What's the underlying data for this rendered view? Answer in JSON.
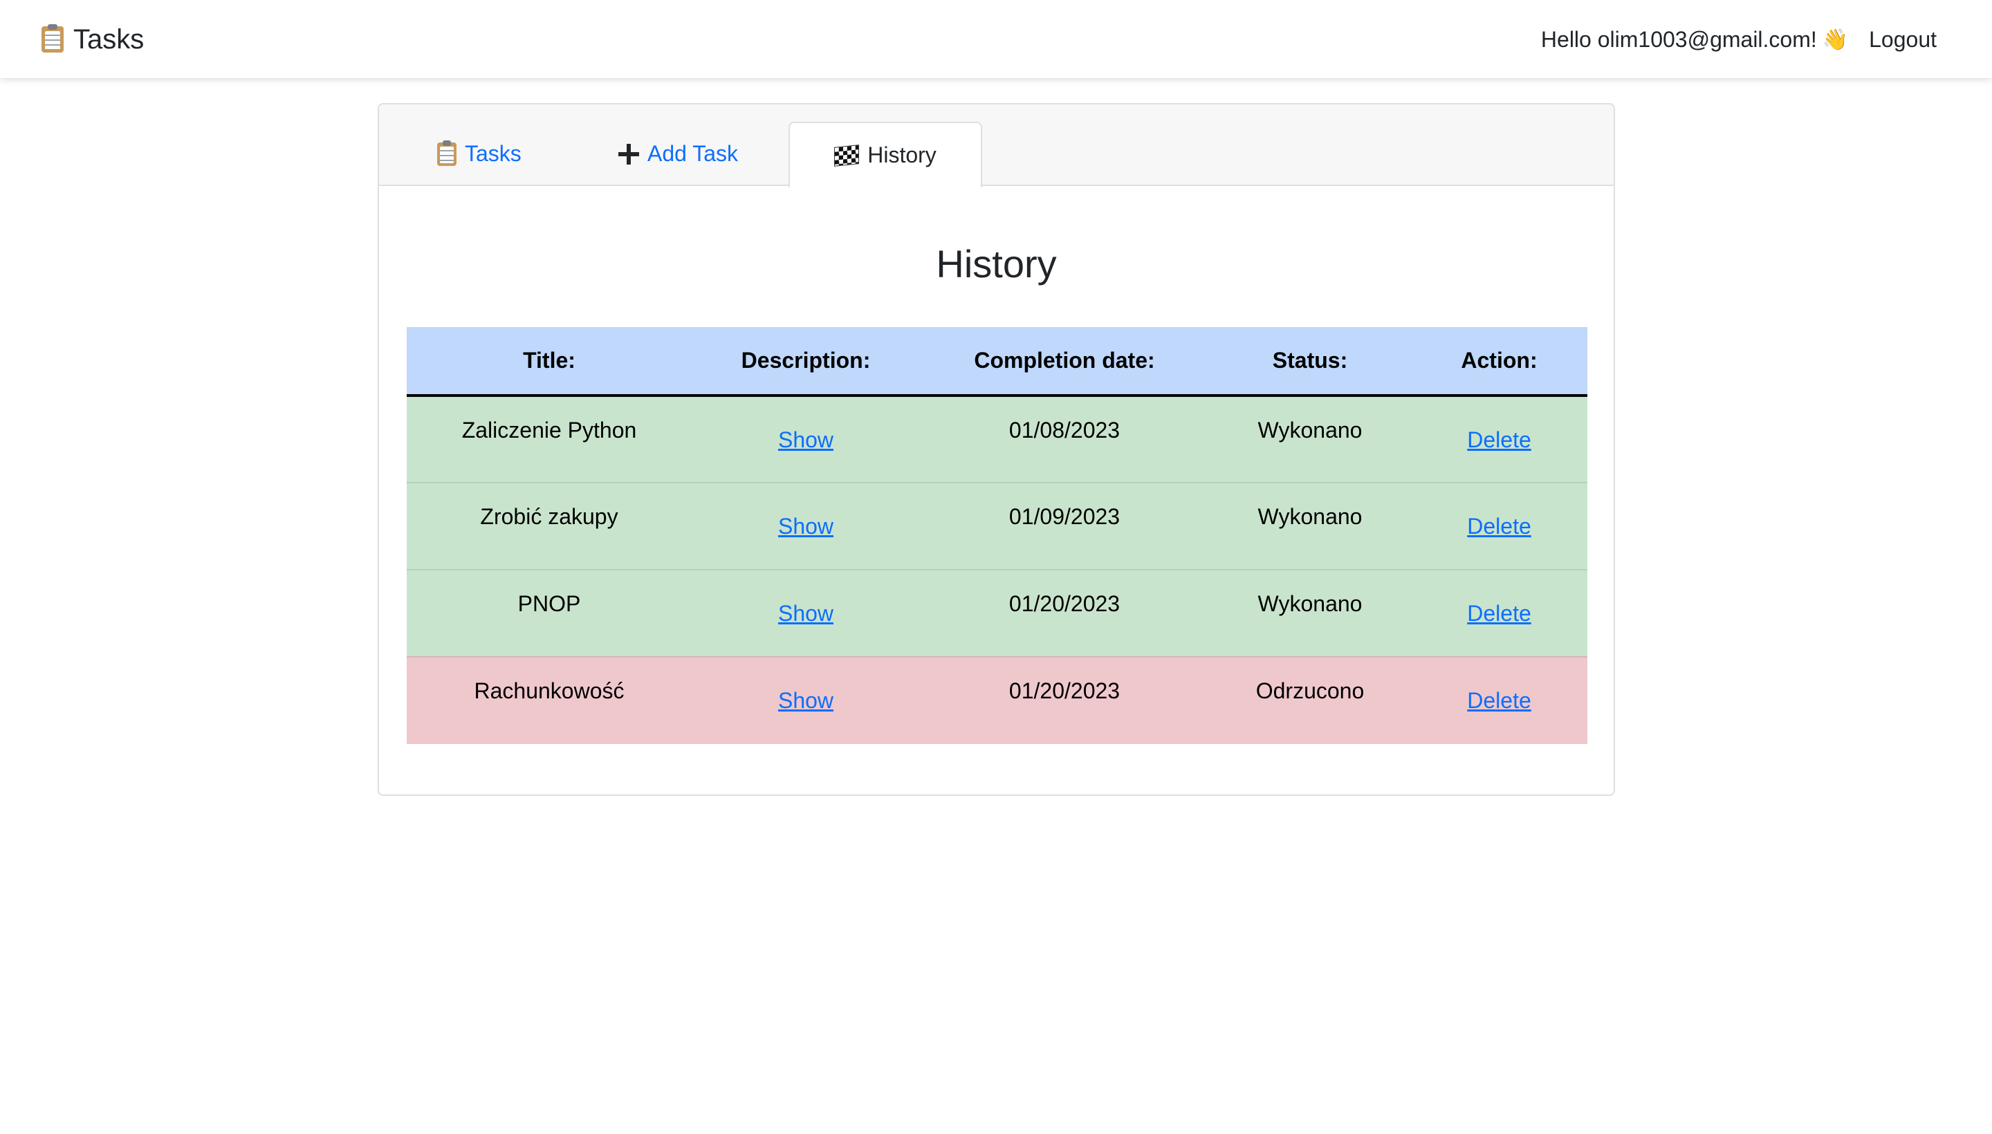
{
  "navbar": {
    "brand": "Tasks",
    "brand_icon": "clipboard-icon",
    "greeting": "Hello olim1003@gmail.com!",
    "greeting_emoji": "👋",
    "logout": "Logout"
  },
  "tabs": [
    {
      "label": "Tasks",
      "icon": "clipboard-icon",
      "active": false
    },
    {
      "label": "Add Task",
      "icon": "plus-icon",
      "active": false
    },
    {
      "label": "History",
      "icon": "checkered-flag-icon",
      "active": true
    }
  ],
  "page": {
    "heading": "History"
  },
  "table": {
    "columns": [
      "Title:",
      "Description:",
      "Completion date:",
      "Status:",
      "Action:"
    ],
    "rows": [
      {
        "title": "Zaliczenie Python",
        "description": "Show",
        "date": "01/08/2023",
        "status": "Wykonano",
        "action": "Delete",
        "state": "done"
      },
      {
        "title": "Zrobić zakupy",
        "description": "Show",
        "date": "01/09/2023",
        "status": "Wykonano",
        "action": "Delete",
        "state": "done"
      },
      {
        "title": "PNOP",
        "description": "Show",
        "date": "01/20/2023",
        "status": "Wykonano",
        "action": "Delete",
        "state": "done"
      },
      {
        "title": "Rachunkowość",
        "description": "Show",
        "date": "01/20/2023",
        "status": "Odrzucono",
        "action": "Delete",
        "state": "rejected"
      }
    ]
  },
  "colors": {
    "link": "#0d6efd",
    "header_row": "#bfd8fb",
    "done_row": "#c9e4cd",
    "rejected_row": "#efc8cc"
  }
}
